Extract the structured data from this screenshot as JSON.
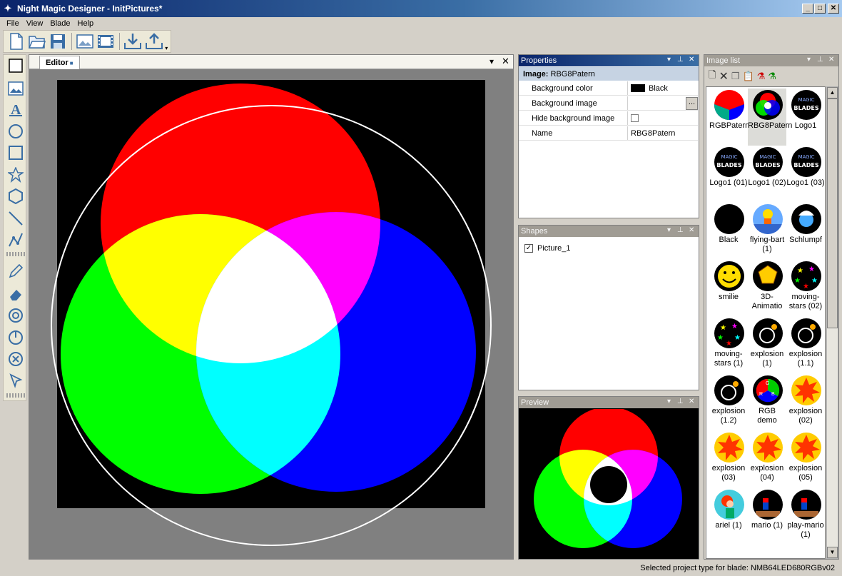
{
  "window": {
    "title": "Night Magic Designer - InitPictures*"
  },
  "menu": [
    "File",
    "View",
    "Blade",
    "Help"
  ],
  "editor": {
    "tab_label": "Editor"
  },
  "properties": {
    "title": "Properties",
    "section": "Image:",
    "section_value": "RBG8Patern",
    "rows": [
      {
        "key": "Background color",
        "value": "Black"
      },
      {
        "key": "Background image",
        "value": ""
      },
      {
        "key": "Hide background image",
        "value": ""
      },
      {
        "key": "Name",
        "value": "RBG8Patern"
      }
    ],
    "browse_label": "..."
  },
  "shapes": {
    "title": "Shapes",
    "items": [
      {
        "label": "Picture_1",
        "checked": true
      }
    ]
  },
  "preview": {
    "title": "Preview"
  },
  "imagelist": {
    "title": "Image list",
    "items": [
      {
        "label": "RGBPatern",
        "thumb": "rgbpatern"
      },
      {
        "label": "RBG8Patern",
        "thumb": "rbg8patern",
        "selected": true
      },
      {
        "label": "Logo1",
        "thumb": "logo"
      },
      {
        "label": "Logo1 (01)",
        "thumb": "logo"
      },
      {
        "label": "Logo1 (02)",
        "thumb": "logo"
      },
      {
        "label": "Logo1 (03)",
        "thumb": "logo"
      },
      {
        "label": "Black",
        "thumb": "black"
      },
      {
        "label": "flying-bart (1)",
        "thumb": "bart"
      },
      {
        "label": "Schlumpf",
        "thumb": "smurf"
      },
      {
        "label": "smilie",
        "thumb": "smilie"
      },
      {
        "label": "3D-Animatio",
        "thumb": "poly"
      },
      {
        "label": "moving-stars (02)",
        "thumb": "stars"
      },
      {
        "label": "moving-stars (1)",
        "thumb": "stars"
      },
      {
        "label": "explosion (1)",
        "thumb": "bomb"
      },
      {
        "label": "explosion (1.1)",
        "thumb": "bomb"
      },
      {
        "label": "explosion (1.2)",
        "thumb": "bomb"
      },
      {
        "label": "RGB demo",
        "thumb": "rgbdemo"
      },
      {
        "label": "explosion (02)",
        "thumb": "boom"
      },
      {
        "label": "explosion (03)",
        "thumb": "boom"
      },
      {
        "label": "explosion (04)",
        "thumb": "boom"
      },
      {
        "label": "explosion (05)",
        "thumb": "boom"
      },
      {
        "label": "ariel (1)",
        "thumb": "ariel"
      },
      {
        "label": "mario (1)",
        "thumb": "mario"
      },
      {
        "label": "play-mario (1)",
        "thumb": "mario"
      }
    ]
  },
  "status": {
    "text": "Selected project type for blade: NMB64LED680RGBv02"
  },
  "colors": {
    "red": "#ff0000",
    "green": "#00ff00",
    "blue": "#0000ff",
    "titlebar": "#0a246a"
  }
}
